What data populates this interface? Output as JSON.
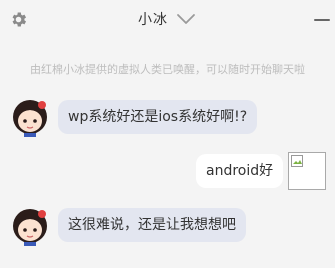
{
  "header": {
    "title": "小冰",
    "settings_icon": "gear-icon",
    "dropdown_icon": "chevron-down-icon",
    "minimize_icon": "minimize-icon"
  },
  "notice": "由红棉小冰提供的虚拟人类已唤醒，可以随时开始聊天啦",
  "messages": [
    {
      "sender": "bot",
      "text": "wp系统好还是ios系统好啊!?"
    },
    {
      "sender": "user",
      "text": "android好"
    },
    {
      "sender": "bot",
      "text": "这很难说，还是让我想想吧"
    }
  ],
  "colors": {
    "background": "#f4f4f4",
    "bot_bubble": "#e3e6f0",
    "user_bubble": "#ffffff",
    "notice_text": "#bdbdbd"
  }
}
